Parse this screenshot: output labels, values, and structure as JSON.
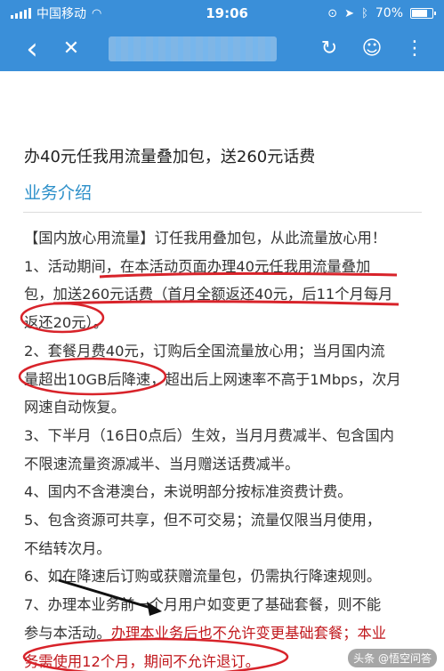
{
  "status_bar": {
    "carrier": "中国移动",
    "time": "19:06",
    "battery": "70%"
  },
  "nav": {
    "back_icon": "‹",
    "close_icon": "✕",
    "refresh_icon": "↻",
    "chat_icon": "☺",
    "more_icon": "⋮"
  },
  "page": {
    "offer_title": "办40元任我用流量叠加包，送260元话费",
    "section_title": "业务介绍",
    "lines": [
      "【国内放心用流量】订任我用叠加包，从此流量放心用！",
      "1、活动期间，在本活动页面办理40元任我用流量叠加",
      "包，加送260元话费（首月全额返还40元，后11个月每月",
      "返还20元）。",
      "2、套餐月费40元，订购后全国流量放心用；当月国内流",
      "量超出10GB后降速，超出后上网速率不高于1Mbps，次月",
      "网速自动恢复。",
      "3、下半月（16日0点后）生效，当月月费减半、包含国内",
      "不限速流量资源减半、当月赠送话费减半。",
      "4、国内不含港澳台，未说明部分按标准资费计费。",
      "5、包含资源可共享，但不可交易；流量仅限当月使用，",
      "不结转次月。",
      "6、如在降速后订购或获赠流量包，仍需执行降速规则。",
      "7、办理本业务前一个月用户如变更了基础套餐，则不能"
    ],
    "line15_black": "参与本活动。",
    "line15_red": "办理本业务后也不允许变更基础套餐；本业",
    "line16_red": "务需使用12个月，期间不允许退订。"
  },
  "watermark": "头条 @悟空问答",
  "colors": {
    "header": "#3a8fd9",
    "section_title": "#2b8fc9",
    "annotation_red": "#d8232a",
    "highlight_red": "#c0161b"
  }
}
